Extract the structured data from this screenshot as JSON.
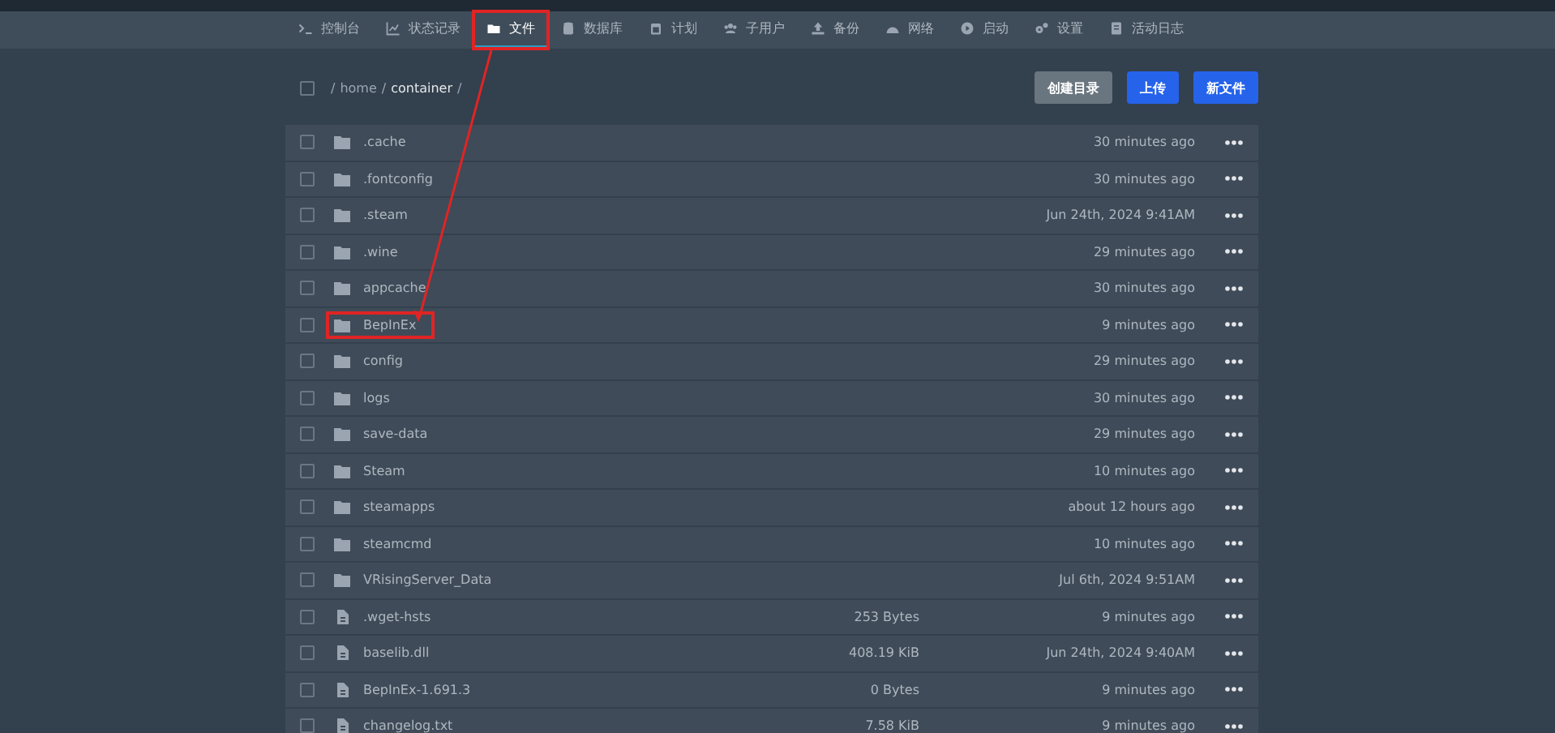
{
  "nav": [
    {
      "label": "控制台",
      "selected": false,
      "highlighted": false
    },
    {
      "label": "状态记录",
      "selected": false,
      "highlighted": false
    },
    {
      "label": "文件",
      "selected": true,
      "highlighted": true
    },
    {
      "label": "数据库",
      "selected": false,
      "highlighted": false
    },
    {
      "label": "计划",
      "selected": false,
      "highlighted": false
    },
    {
      "label": "子用户",
      "selected": false,
      "highlighted": false
    },
    {
      "label": "备份",
      "selected": false,
      "highlighted": false
    },
    {
      "label": "网络",
      "selected": false,
      "highlighted": false
    },
    {
      "label": "启动",
      "selected": false,
      "highlighted": false
    },
    {
      "label": "设置",
      "selected": false,
      "highlighted": false
    },
    {
      "label": "活动日志",
      "selected": false,
      "highlighted": false
    }
  ],
  "toolbar": {
    "select_all_checked": false,
    "breadcrumb": [
      {
        "kind": "separator",
        "text": "/"
      },
      {
        "kind": "link",
        "text": "home"
      },
      {
        "kind": "separator",
        "text": "/"
      },
      {
        "kind": "current",
        "text": "container"
      },
      {
        "kind": "separator",
        "text": "/"
      }
    ],
    "buttons": [
      {
        "label": "创建目录",
        "kind": "secondary"
      },
      {
        "label": "上传",
        "kind": "primary"
      },
      {
        "label": "新文件",
        "kind": "primary"
      }
    ]
  },
  "files": [
    {
      "kind": "folder",
      "name": ".cache",
      "modified": "30 minutes ago",
      "checked": false,
      "highlighted": false
    },
    {
      "kind": "folder",
      "name": ".fontconfig",
      "modified": "30 minutes ago",
      "checked": false,
      "highlighted": false
    },
    {
      "kind": "folder",
      "name": ".steam",
      "modified": "Jun 24th, 2024 9:41AM",
      "checked": false,
      "highlighted": false
    },
    {
      "kind": "folder",
      "name": ".wine",
      "modified": "29 minutes ago",
      "checked": false,
      "highlighted": false
    },
    {
      "kind": "folder",
      "name": "appcache",
      "modified": "30 minutes ago",
      "checked": false,
      "highlighted": false
    },
    {
      "kind": "folder",
      "name": "BepInEx",
      "modified": "9 minutes ago",
      "checked": false,
      "highlighted": true
    },
    {
      "kind": "folder",
      "name": "config",
      "modified": "29 minutes ago",
      "checked": false,
      "highlighted": false
    },
    {
      "kind": "folder",
      "name": "logs",
      "modified": "30 minutes ago",
      "checked": false,
      "highlighted": false
    },
    {
      "kind": "folder",
      "name": "save-data",
      "modified": "29 minutes ago",
      "checked": false,
      "highlighted": false
    },
    {
      "kind": "folder",
      "name": "Steam",
      "modified": "10 minutes ago",
      "checked": false,
      "highlighted": false
    },
    {
      "kind": "folder",
      "name": "steamapps",
      "modified": "about 12 hours ago",
      "checked": false,
      "highlighted": false
    },
    {
      "kind": "folder",
      "name": "steamcmd",
      "modified": "10 minutes ago",
      "checked": false,
      "highlighted": false
    },
    {
      "kind": "folder",
      "name": "VRisingServer_Data",
      "modified": "Jul 6th, 2024 9:51AM",
      "checked": false,
      "highlighted": false
    },
    {
      "kind": "file",
      "name": ".wget-hsts",
      "size": "253 Bytes",
      "modified": "9 minutes ago",
      "checked": false,
      "highlighted": false
    },
    {
      "kind": "file",
      "name": "baselib.dll",
      "size": "408.19 KiB",
      "modified": "Jun 24th, 2024 9:40AM",
      "checked": false,
      "highlighted": false
    },
    {
      "kind": "file",
      "name": "BepInEx-1.691.3",
      "size": "0 Bytes",
      "modified": "9 minutes ago",
      "checked": false,
      "highlighted": false
    },
    {
      "kind": "file",
      "name": "changelog.txt",
      "size": "7.58 KiB",
      "modified": "9 minutes ago",
      "checked": false,
      "highlighted": false
    }
  ]
}
